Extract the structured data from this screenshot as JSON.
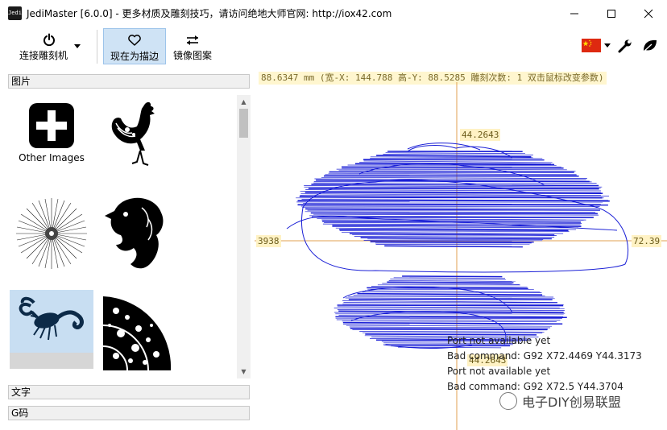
{
  "window": {
    "title": "JediMaster [6.0.0] - 更多材质及雕刻技巧，请访问绝地大师官网: http://iox42.com",
    "app_icon_text": "Jedi"
  },
  "toolbar": {
    "connect_label": "连接雕刻机",
    "outline_label": "现在为描边",
    "mirror_label": "镜像图案"
  },
  "panels": {
    "images_header": "图片",
    "text_header": "文字",
    "gcode_header": "G码",
    "other_images_label": "Other Images"
  },
  "canvas": {
    "status_text": "88.6347 mm  (宽-X: 144.788  高-Y: 88.5285  雕刻次数: 1  双击鼠标改变参数)",
    "axis_top_label": "44.2643",
    "axis_left_label": "3938",
    "axis_right_label": "72.39",
    "axis_bottom_label": "44.2643",
    "colors": {
      "path": "#1a1fd6",
      "axis": "#e0a050",
      "label_bg": "#fff2c4"
    }
  },
  "log": {
    "lines": [
      "Port not available yet",
      "Bad command: G92 X72.4469 Y44.3173",
      "Port not available yet",
      "Bad command: G92 X72.5 Y44.3704"
    ]
  },
  "watermark": {
    "text": "电子DIY创易联盟"
  }
}
